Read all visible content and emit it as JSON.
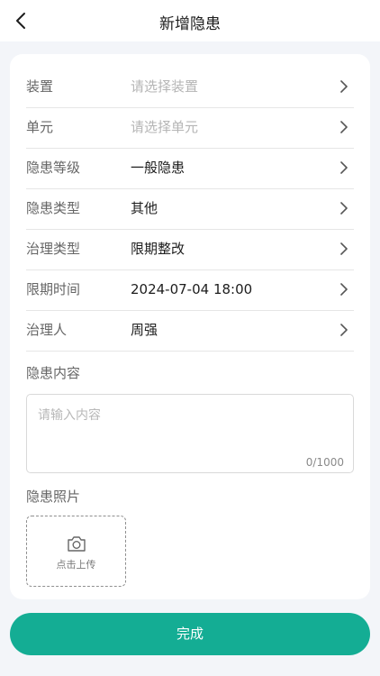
{
  "header": {
    "title": "新增隐患"
  },
  "form": {
    "rows": [
      {
        "label": "装置",
        "value": "请选择装置"
      },
      {
        "label": "单元",
        "value": "请选择单元"
      },
      {
        "label": "隐患等级",
        "value": "一般隐患"
      },
      {
        "label": "隐患类型",
        "value": "其他"
      },
      {
        "label": "治理类型",
        "value": "限期整改"
      },
      {
        "label": "限期时间",
        "value": "2024-07-04 18:00"
      },
      {
        "label": "治理人",
        "value": "周强"
      }
    ],
    "content": {
      "label": "隐患内容",
      "placeholder": "请输入内容",
      "char_count": "0/1000"
    },
    "photos": {
      "label": "隐患照片",
      "upload_label": "点击上传"
    }
  },
  "footer": {
    "done_label": "完成"
  },
  "colors": {
    "accent": "#14ad94",
    "background": "#f3f5f9"
  },
  "icons": {
    "back": "chevron-left-icon",
    "row_arrow": "chevron-right-icon",
    "upload": "camera-icon"
  }
}
